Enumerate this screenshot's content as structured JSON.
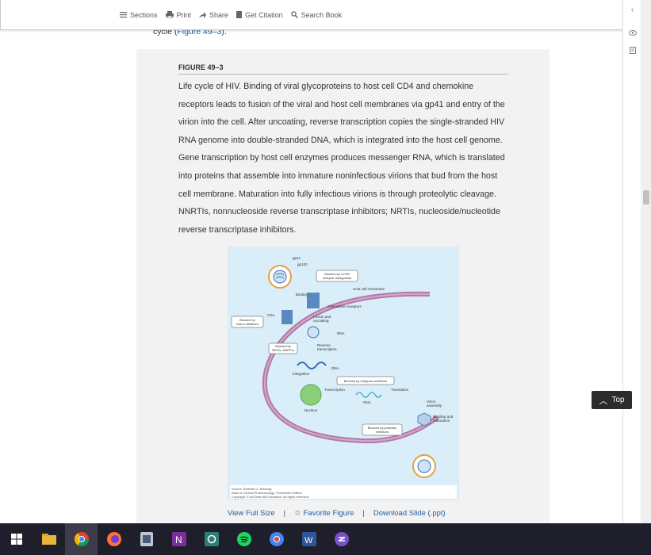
{
  "toolbar": {
    "sections": "Sections",
    "print": "Print",
    "share": "Share",
    "citation": "Get Citation",
    "search": "Search Book"
  },
  "prev": {
    "text": "cycle (",
    "link": "Figure 49–3",
    "tail": ")."
  },
  "figure": {
    "label": "FIGURE 49–3",
    "caption": "Life cycle of HIV. Binding of viral glycoproteins to host cell CD4 and chemokine receptors leads to fusion of the viral and host cell membranes via gp41 and entry of the virion into the cell. After uncoating, reverse transcription copies the single-stranded HIV RNA genome into double-stranded DNA, which is integrated into the host cell genome. Gene transcription by host cell enzymes produces messenger RNA, which is translated into proteins that assemble into immature noninfectious virions that bud from the host cell membrane. Maturation into fully infectious virions is through proteolytic cleavage. NNRTIs, nonnucleoside reverse transcriptase inhibitors; NRTIs, nucleoside/nucleotide reverse transcriptase inhibitors.",
    "credit_1": "Source: Bertram G. Katzung:",
    "credit_2": "Basic & Clinical Pharmacology, Fourteenth Edition",
    "credit_3": "Copyright © McGraw-Hill Education. All rights reserved.",
    "diagram": {
      "gp41": "gp41",
      "gp120": "gp120",
      "ccr5": "Blocked by CCR5",
      "ccr5b": "receptor antagonists",
      "binding": "Binding",
      "host_membrane": "Host cell membrane",
      "chemokine": "Chemokine receptors",
      "cd4": "CD4",
      "fusion_block": "Blocked by",
      "fusion_block_b": "fusion inhibitors",
      "fusion": "Fusion and",
      "fusion_b": "uncoating",
      "rna": "RNA",
      "nrti": "Blocked by",
      "nrti_b": "NRTIs, NNRTIs",
      "reverse": "Reverse",
      "reverse_b": "transcription",
      "dna": "DNA",
      "integration": "Integration",
      "integrase": "Blocked by integrase inhibitors",
      "transcription": "Transcription",
      "translation": "Translation",
      "nucleus": "Nucleus",
      "rna2": "RNA",
      "virion": "Virion",
      "virion_b": "assembly",
      "budding": "Budding and",
      "budding_b": "maturation",
      "protease": "Blocked by protease",
      "protease_b": "inhibitors"
    }
  },
  "actions": {
    "view": "View Full Size",
    "favorite": "Favorite Figure",
    "download": "Download Slide (.ppt)"
  },
  "top_button": "Top",
  "colors": {
    "link": "#1d5fa6",
    "panel": "#f2f2f2",
    "figure_bg": "#d9eef8",
    "membrane": "#b07aa6",
    "taskbar": "#1f1f2b"
  }
}
